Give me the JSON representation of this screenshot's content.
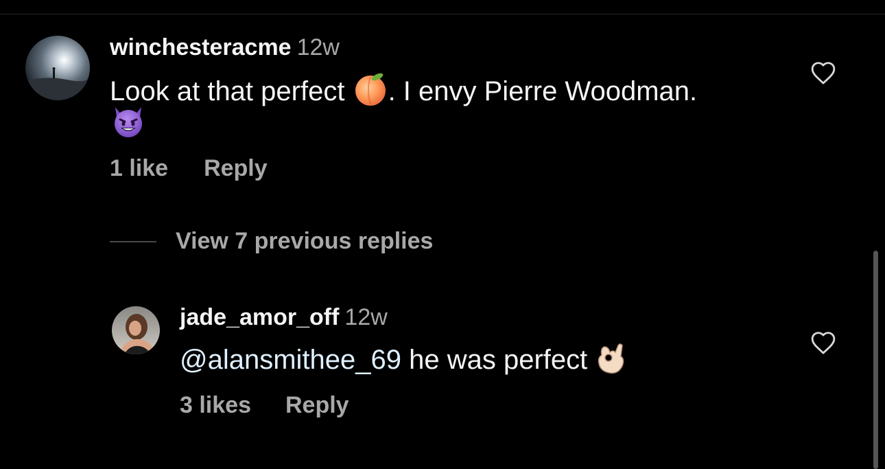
{
  "colors": {
    "background": "#000000",
    "primary_text": "#f5f5f5",
    "secondary_text": "#a8a8a8",
    "mention": "#e0f1ff"
  },
  "comments": [
    {
      "username": "winchesteracme",
      "time": "12w",
      "text_before": "Look at that perfect ",
      "emoji_1": "peach-emoji",
      "text_after": ". I envy Pierre Woodman.",
      "emoji_2": "smiling-devil-emoji",
      "likes": "1 like",
      "reply_label": "Reply",
      "like_icon": "heart-outline-icon"
    }
  ],
  "view_replies": {
    "label": "View 7 previous replies"
  },
  "replies": [
    {
      "username": "jade_amor_off",
      "time": "12w",
      "mention": "@alansmithee_69",
      "text": " he was perfect ",
      "emoji": "ok-hand-emoji",
      "likes": "3 likes",
      "reply_label": "Reply",
      "like_icon": "heart-outline-icon"
    }
  ]
}
